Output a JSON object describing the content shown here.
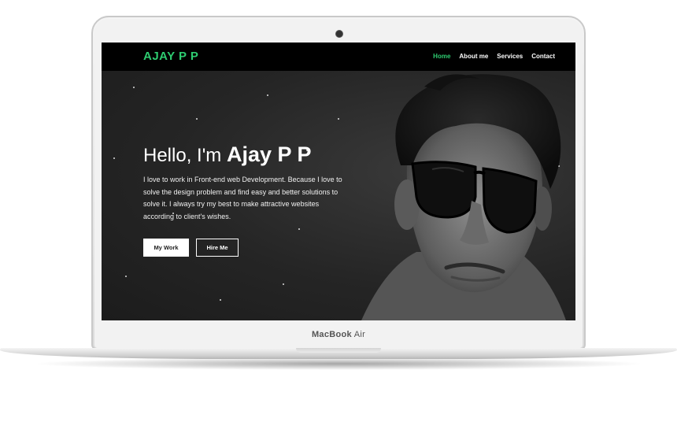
{
  "device": {
    "model_brand": "MacBook",
    "model_name": "Air"
  },
  "site": {
    "logo": "AJAY P P",
    "nav": [
      {
        "label": "Home",
        "active": true
      },
      {
        "label": "About me",
        "active": false
      },
      {
        "label": "Services",
        "active": false
      },
      {
        "label": "Contact",
        "active": false
      }
    ],
    "hero": {
      "greeting": "Hello, I'm",
      "name": "Ajay P P",
      "description": "I love to work in Front-end web Development. Because I love to solve the design problem and find easy and better solutions to solve it. I always try my best to make attractive websites according to client's wishes.",
      "buttons": {
        "primary": "My Work",
        "secondary": "Hire Me"
      }
    }
  },
  "colors": {
    "accent": "#2ecc71",
    "navbar": "#000000",
    "hero_bg": "#252525"
  }
}
